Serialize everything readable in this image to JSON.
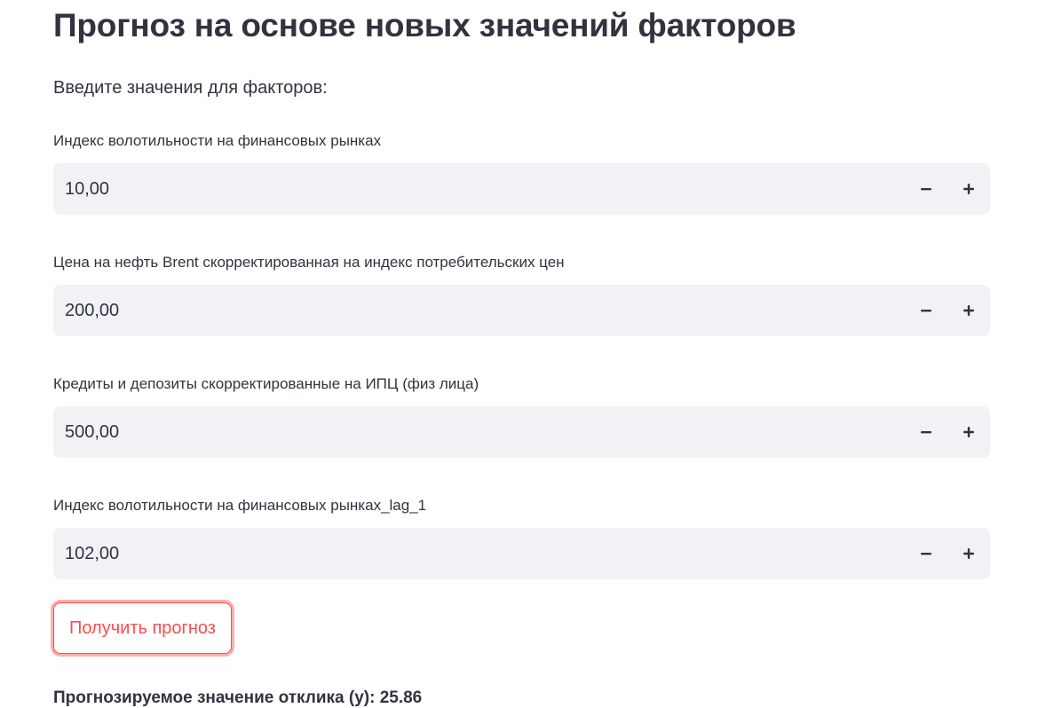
{
  "page": {
    "title": "Прогноз на основе новых значений факторов",
    "intro": "Введите значения для факторов:"
  },
  "fields": [
    {
      "label": "Индекс волотильности на финансовых рынках",
      "value": "10,00"
    },
    {
      "label": "Цена на нефть Brent скорректированная на индекс потребительских цен",
      "value": "200,00"
    },
    {
      "label": "Кредиты и депозиты скорректированные на ИПЦ (физ лица)",
      "value": "500,00"
    },
    {
      "label": "Индекс волотильности на финансовых рынках_lag_1",
      "value": "102,00"
    }
  ],
  "stepper": {
    "decrement_icon": "minus-icon",
    "increment_icon": "plus-icon"
  },
  "actions": {
    "predict_label": "Получить прогноз"
  },
  "result": {
    "text": "Прогнозируемое значение отклика (y): 25.86"
  },
  "colors": {
    "text": "#31333f",
    "input_bg": "#f0f2f6",
    "accent": "#ff4b4b",
    "background": "#ffffff"
  }
}
